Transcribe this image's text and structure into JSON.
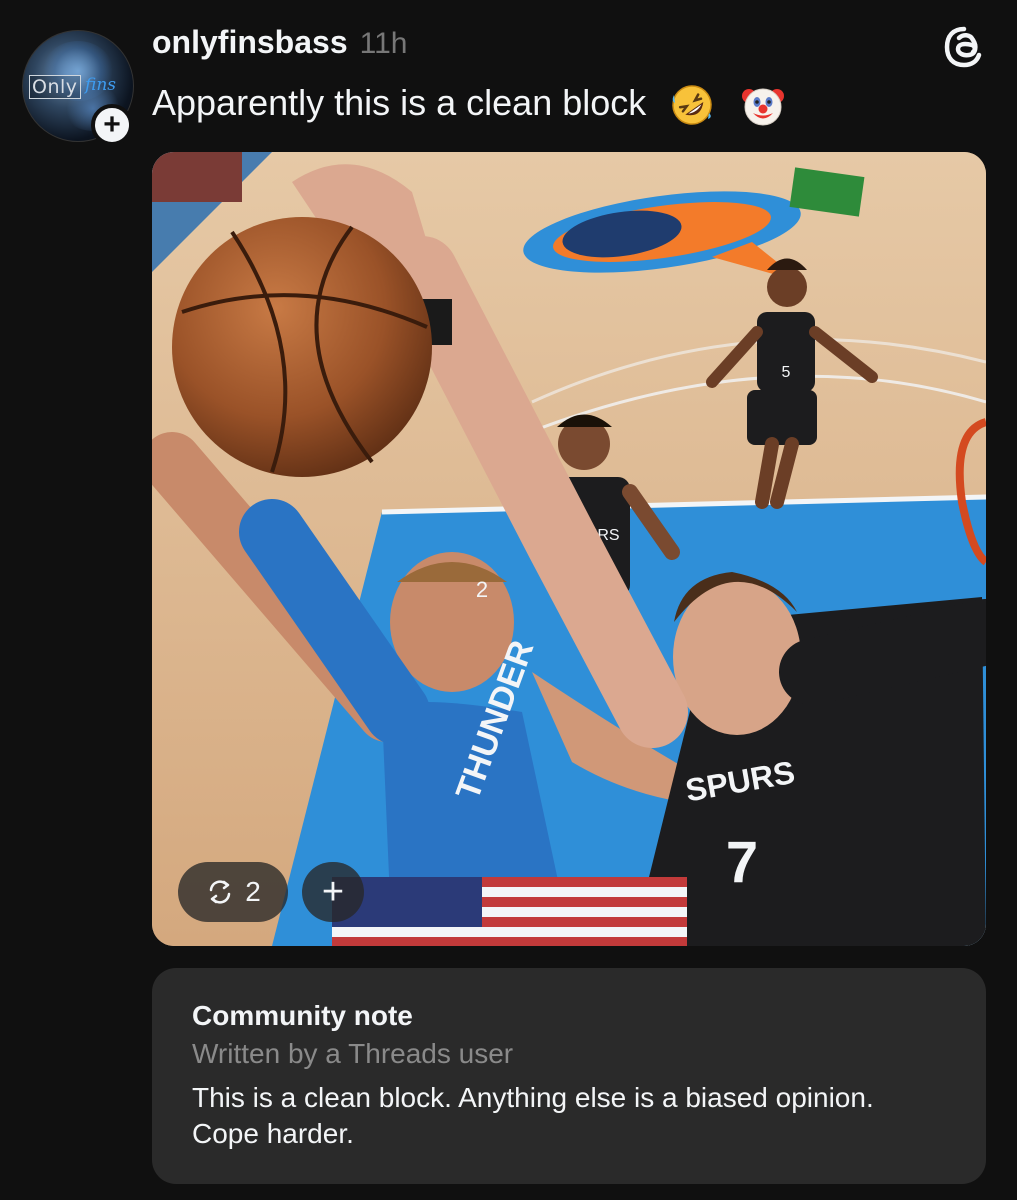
{
  "post": {
    "username": "onlyfinsbass",
    "timestamp": "11h",
    "text": "Apparently this is a clean block",
    "emojis": [
      "rolling-on-floor-laughing",
      "clown-face"
    ],
    "avatar": {
      "logo_text": "Only",
      "logo_script": "fins"
    },
    "media": {
      "jersey_numbers": [
        "5",
        "2",
        "7",
        "2"
      ],
      "jersey_texts": [
        "SPURS",
        "SPURS",
        "THUNDER"
      ]
    },
    "repost_count": "2"
  },
  "community_note": {
    "title": "Community note",
    "subtitle": "Written by a Threads user",
    "body": "This is a clean block. Anything else is a biased opinion. Cope harder."
  },
  "colors": {
    "background": "#101010",
    "text_primary": "#f3f5f7",
    "text_secondary": "#777777",
    "note_background": "#2a2a2a",
    "thunder_blue": "#2f8fd8",
    "spurs_black": "#1c1c1e"
  }
}
